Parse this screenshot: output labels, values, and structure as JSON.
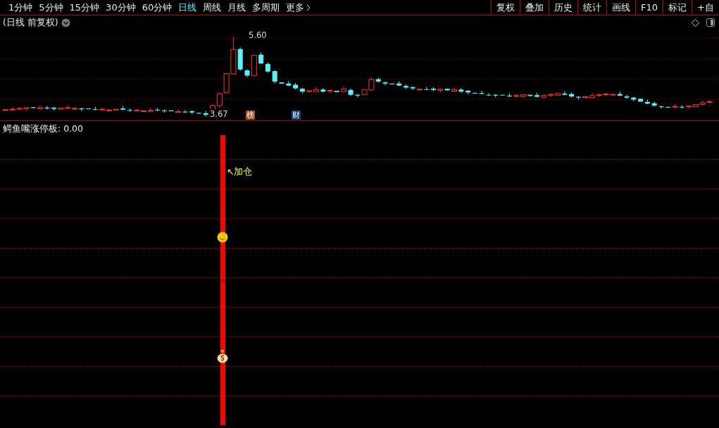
{
  "toolbar": {
    "periods": [
      {
        "label": "1分钟",
        "selected": false
      },
      {
        "label": "5分钟",
        "selected": false
      },
      {
        "label": "15分钟",
        "selected": false
      },
      {
        "label": "30分钟",
        "selected": false
      },
      {
        "label": "60分钟",
        "selected": false
      },
      {
        "label": "日线",
        "selected": true
      },
      {
        "label": "周线",
        "selected": false
      },
      {
        "label": "月线",
        "selected": false
      },
      {
        "label": "多周期",
        "selected": false
      }
    ],
    "more": "更多",
    "buttons": [
      "复权",
      "叠加",
      "历史",
      "统计",
      "画线",
      "F10",
      "标记",
      "+自"
    ]
  },
  "chart": {
    "title": "(日线 前复权)",
    "high_label": "5.60",
    "low_label": "3.67",
    "markers": [
      {
        "text": "榜",
        "color": "#9c4f12"
      },
      {
        "text": "财",
        "color": "#123f78"
      }
    ]
  },
  "indicator": {
    "label": "鳄鱼嘴涨停板: 0.00",
    "signal": "↖加仓"
  }
}
